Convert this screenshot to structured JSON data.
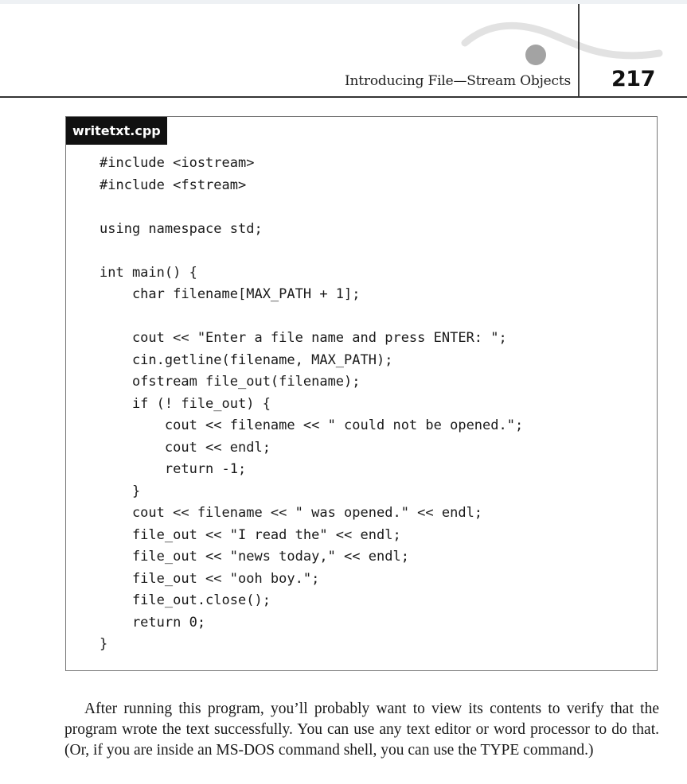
{
  "header": {
    "running_head": "Introducing File—Stream Objects",
    "page_number": "217"
  },
  "listing": {
    "filename": "writetxt.cpp",
    "lines": [
      "#include <iostream>",
      "#include <fstream>",
      "",
      "using namespace std;",
      "",
      "int main() {",
      "    char filename[MAX_PATH + 1];",
      "",
      "    cout << \"Enter a file name and press ENTER: \";",
      "    cin.getline(filename, MAX_PATH);",
      "    ofstream file_out(filename);",
      "    if (! file_out) {",
      "        cout << filename << \" could not be opened.\";",
      "        cout << endl;",
      "        return -1;",
      "    }",
      "    cout << filename << \" was opened.\" << endl;",
      "    file_out << \"I read the\" << endl;",
      "    file_out << \"news today,\" << endl;",
      "    file_out << \"ooh boy.\";",
      "    file_out.close();",
      "    return 0;",
      "}"
    ]
  },
  "body": {
    "paragraph": "After running this program, you’ll probably want to view its contents to verify that the program wrote the text successfully. You can use any text editor or word processor to do that. (Or, if you are inside an MS-DOS command shell, you can use the TYPE command.)"
  }
}
